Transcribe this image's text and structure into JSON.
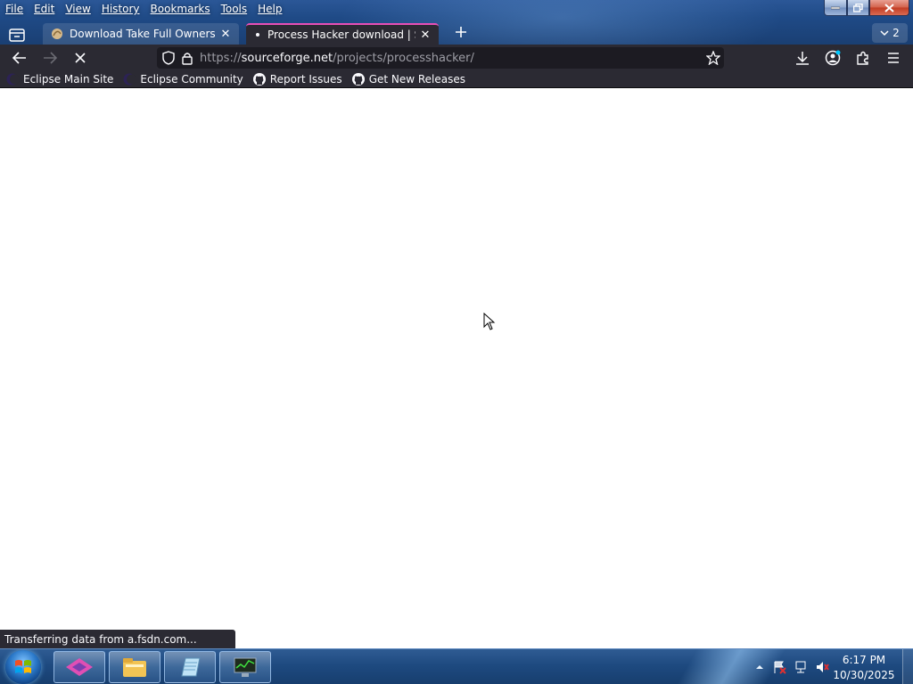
{
  "menubar": {
    "file": "File",
    "edit": "Edit",
    "view": "View",
    "history": "History",
    "bookmarks": "Bookmarks",
    "tools": "Tools",
    "help": "Help"
  },
  "tabs": [
    {
      "title": "Download Take Full Ownership",
      "icon": "tab-favicon-icon"
    },
    {
      "title": "Process Hacker download | SourceForge",
      "icon": "loading-dot-icon"
    }
  ],
  "tab_counter": "2",
  "urlbar": {
    "scheme": "https://",
    "host": "sourceforge.net",
    "path": "/projects/processhacker/"
  },
  "bookmarks": [
    {
      "label": "Eclipse Main Site",
      "icon": "eclipse-icon"
    },
    {
      "label": "Eclipse Community",
      "icon": "eclipse-icon"
    },
    {
      "label": "Report Issues",
      "icon": "github-icon"
    },
    {
      "label": "Get New Releases",
      "icon": "github-icon"
    }
  ],
  "status_text": "Transferring data from a.fsdn.com...",
  "taskbar": {
    "clock_time": "6:17 PM",
    "clock_date": "10/30/2025"
  },
  "colors": {
    "tab_accent": "#e84fb7",
    "toolbar_bg": "#2b2a33",
    "urlbar_bg": "#1c1b22"
  }
}
